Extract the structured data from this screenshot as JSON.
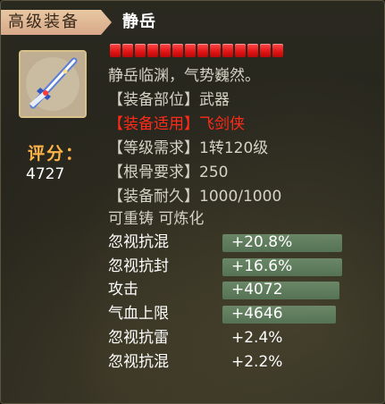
{
  "header": {
    "category_label": "高级装备",
    "item_name": "静岳"
  },
  "item_icon": "sword-icon",
  "score": {
    "label": "评分：",
    "value": "4727"
  },
  "durability_pips": 14,
  "description": {
    "flavor": "静岳临渊，气势巍然。",
    "slot": "【装备部位】武器",
    "applicable": "【装备适用】飞剑侠",
    "level_req": "【等级需求】1转120级",
    "bone_req": "【根骨要求】250",
    "durability": "【装备耐久】1000/1000",
    "flags": "可重铸 可炼化"
  },
  "stats": [
    {
      "name": "忽视抗混",
      "value": "+20.8%",
      "fill": 1.0
    },
    {
      "name": "忽视抗封",
      "value": "+16.6%",
      "fill": 1.0
    },
    {
      "name": "攻击",
      "value": "+4072",
      "fill": 0.98
    },
    {
      "name": "气血上限",
      "value": "+4646",
      "fill": 0.95
    },
    {
      "name": "忽视抗雷",
      "value": "+2.4%",
      "fill": 0
    },
    {
      "name": "忽视抗混",
      "value": "+2.2%",
      "fill": 0
    }
  ],
  "colors": {
    "score_label": "#ffb44a",
    "required_highlight": "#ff2a1a",
    "pip": "#e01414",
    "bar": "#6f8f6d"
  }
}
